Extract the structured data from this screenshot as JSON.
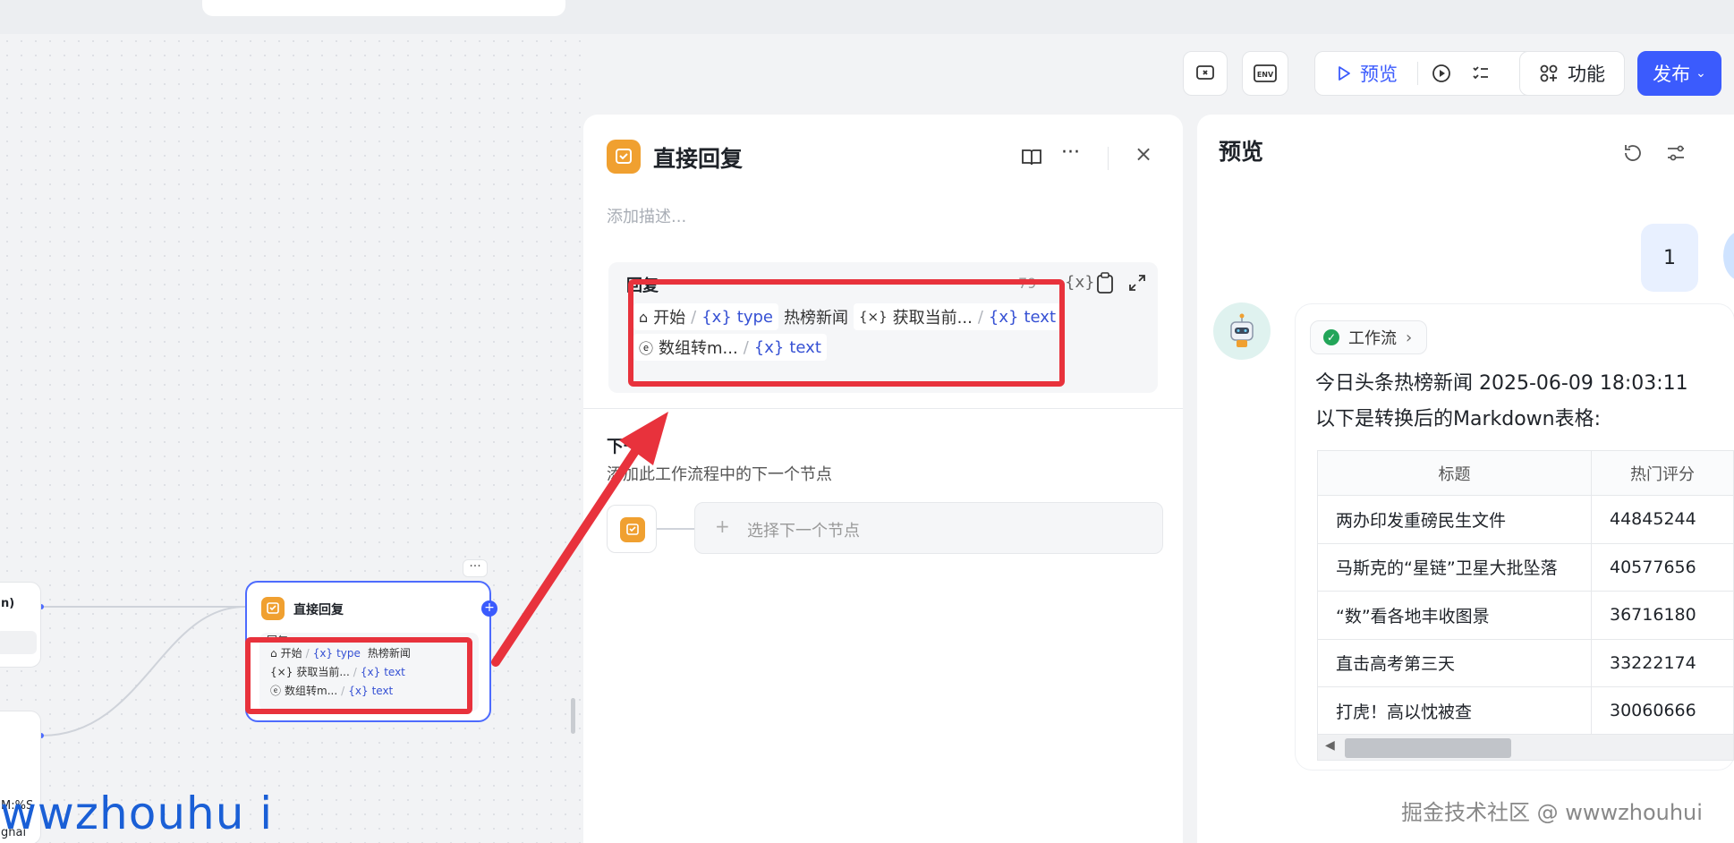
{
  "toolbar": {
    "preview_label": "预览",
    "features_label": "功能",
    "publish_label": "发布"
  },
  "canvas_node": {
    "title": "直接回复",
    "body_label": "回复",
    "rows": [
      {
        "source": "开始",
        "var": "type",
        "suffix": "热榜新闻"
      },
      {
        "source": "获取当前...",
        "var": "text"
      },
      {
        "source": "数组转m...",
        "var": "text"
      }
    ],
    "stub_fragments": [
      "n)",
      "M:%S",
      "ghai"
    ]
  },
  "panel": {
    "title": "直接回复",
    "description_placeholder": "添加描述...",
    "reply": {
      "label": "回复",
      "count": "79",
      "row1": {
        "source": "开始",
        "var": "type",
        "text": "热榜新闻",
        "source2": "获取当前...",
        "var2": "text"
      },
      "row2": {
        "source": "数组转m...",
        "var": "text"
      }
    },
    "next_step": {
      "label": "下一步",
      "description": "添加此工作流程中的下一个节点",
      "select_placeholder": "选择下一个节点"
    }
  },
  "preview": {
    "title": "预览",
    "user_message": "1",
    "workflow_tag": "工作流",
    "line1": "今日头条热榜新闻 2025-06-09 18:03:11",
    "line2": "以下是转换后的Markdown表格:",
    "table": {
      "headers": [
        "标题",
        "热门评分"
      ],
      "rows": [
        [
          "两办印发重磅民生文件",
          "44845244"
        ],
        [
          "马斯克的“星链”卫星大批坠落",
          "40577656"
        ],
        [
          "“数”看各地丰收图景",
          "36716180"
        ],
        [
          "直击高考第三天",
          "33222174"
        ],
        [
          "打虎！高以忱被查",
          "30060666"
        ]
      ]
    }
  },
  "watermarks": {
    "left": "wwzhouhu i",
    "right": "掘金技术社区 @ wwwzhouhui"
  },
  "colors": {
    "accent": "#4d6bfe",
    "publish": "#3b5bfd",
    "node_icon": "#f0a030",
    "annotation": "#e8323c"
  }
}
